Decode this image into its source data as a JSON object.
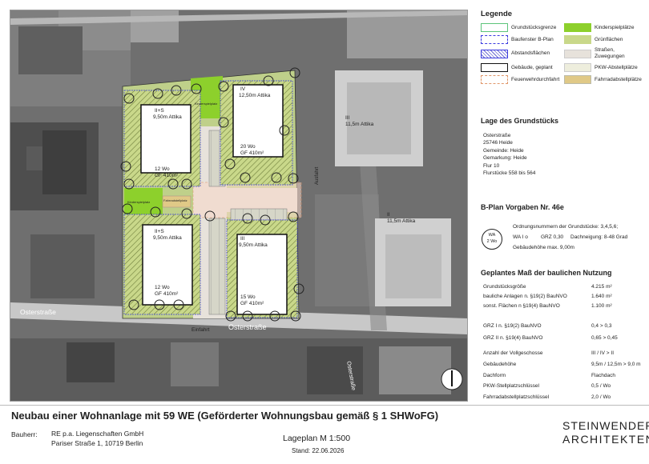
{
  "legend": {
    "title": "Legende",
    "items": [
      {
        "label": "Grundstücksgrenze",
        "swatch": "grenze"
      },
      {
        "label": "Kinderspielplätze",
        "swatch": "spiel"
      },
      {
        "label": "Baufenster B-Plan",
        "swatch": "baufenster"
      },
      {
        "label": "Grünflächen",
        "swatch": "gruen"
      },
      {
        "label": "Abstandsflächen",
        "swatch": "abstand"
      },
      {
        "label": "Straßen, Zuwegungen",
        "swatch": "strasse"
      },
      {
        "label": "Gebäude, geplant",
        "swatch": "gebaeude"
      },
      {
        "label": "PKW-Abstellplätze",
        "swatch": "pkw"
      },
      {
        "label": "Feuerwehrdurchfahrt",
        "swatch": "feuerwehr"
      },
      {
        "label": "Fahrradabstellplätze",
        "swatch": "fahrrad"
      }
    ]
  },
  "lage": {
    "title": "Lage des Grundstücks",
    "lines": [
      "Osterstraße",
      "25746 Heide",
      "Gemeinde: Heide",
      "Gemarkung: Heide",
      "Flur 10",
      "Flurstücke 558 bis 564"
    ]
  },
  "bplan": {
    "title": "B-Plan Vorgaben Nr. 46e",
    "symbol_top": "WA",
    "symbol_bottom": "2 Wo",
    "line1": "Ordnungsnummern der Grundstücke: 3,4,5,6;",
    "line2a": "WA I o",
    "line2b": "GRZ 0,30",
    "line2c": "Dachneigung: 8-48 Grad",
    "line3": "Gebäudehöhe max. 9,00m"
  },
  "mass": {
    "title": "Geplantes Maß der baulichen Nutzung",
    "rows": [
      {
        "label": "Grundstücksgröße",
        "value": "4.215 m²"
      },
      {
        "label": "bauliche Anlagen n. §19(2) BauNVO",
        "value": "1.640 m²"
      },
      {
        "label": "sonst. Flächen n §19(4) BauNVO",
        "value": "1.100 m²"
      },
      {
        "label": "GRZ I n. §19(2) BauNVO",
        "value": "0,4 > 0,3"
      },
      {
        "label": "GRZ II n. §19(4) BauNVO",
        "value": "0,65 > 0,45"
      },
      {
        "label": "Anzahl der Vollgeschosse",
        "value": "III / IV > II"
      },
      {
        "label": "Gebäudehöhe",
        "value": "9,5m / 12,5m > 9,0 m"
      },
      {
        "label": "Dachform",
        "value": "Flachdach"
      },
      {
        "label": "PKW-Stellplatzschlüssel",
        "value": "0,5 / Wo"
      },
      {
        "label": "Fahrradabstellplatzschlüssel",
        "value": "2,0 / Wo"
      }
    ]
  },
  "map": {
    "buildings": [
      {
        "floors": "II+S",
        "height": "9,50m Attika",
        "units": "12 Wo",
        "gf": "GF 410m²"
      },
      {
        "floors": "IV",
        "height": "12,50m Attika",
        "units": "20 Wo",
        "gf": "GF 410m²"
      },
      {
        "floors": "II+S",
        "height": "9,50m Attika",
        "units": "12 Wo",
        "gf": "GF 410m²"
      },
      {
        "floors": "III",
        "height": "9,50m Attika",
        "units": "15 Wo",
        "gf": "GF 410m²"
      }
    ],
    "neighbours": [
      {
        "floors": "III",
        "height": "11,5m Attika"
      },
      {
        "floors": "II",
        "height": "11,5m Attika"
      }
    ],
    "street1": "Osterstraße",
    "street2": "Osterstraße",
    "street3": "Osterstraße",
    "entry": "Einfahrt",
    "exit": "Ausfahrt",
    "playground1": "Kinderspielplatz",
    "playground2": "Kinderspielplatz",
    "bike": "Fahrradstellplatz"
  },
  "footer": {
    "title": "Neubau einer Wohnanlage mit 59 WE (Geförderter Wohnungsbau gemäß § 1 SHWoFG)",
    "bauherr_label": "Bauherr:",
    "bauherr_name": "RE p.a. Liegenschaften GmbH",
    "bauherr_address": "Pariser Straße 1, 10719 Berlin",
    "plan": "Lageplan M 1:500",
    "date": "Stand: 22.06.2026",
    "logo1": "STEINWENDER",
    "logo2": "ARCHITEKTEN"
  }
}
